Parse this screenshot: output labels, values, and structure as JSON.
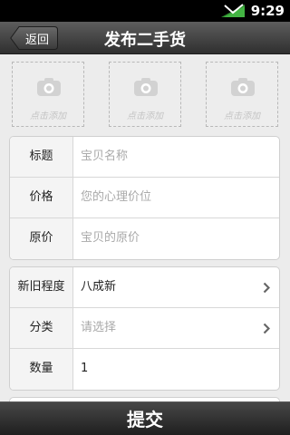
{
  "status_bar": {
    "time": "9:29",
    "signal_icon": "signal-icon"
  },
  "header": {
    "back_label": "返回",
    "title": "发布二手货"
  },
  "photos": [
    {
      "label": "点击添加",
      "icon": "camera-icon"
    },
    {
      "label": "点击添加",
      "icon": "camera-icon"
    },
    {
      "label": "点击添加",
      "icon": "camera-icon"
    }
  ],
  "form_basic": [
    {
      "label": "标题",
      "placeholder": "宝贝名称"
    },
    {
      "label": "价格",
      "placeholder": "您的心理价位"
    },
    {
      "label": "原价",
      "placeholder": "宝贝的原价"
    }
  ],
  "form_details": [
    {
      "label": "新旧程度",
      "value": "八成新",
      "icon": "chevron-right-icon"
    },
    {
      "label": "分类",
      "placeholder": "请选择",
      "icon": "chevron-right-icon"
    },
    {
      "label": "数量",
      "value": "1"
    }
  ],
  "footer": {
    "submit_label": "提交"
  },
  "colors": {
    "title_bar": "#3e3e3e",
    "background": "#ececec",
    "placeholder": "#a9a9a9"
  }
}
